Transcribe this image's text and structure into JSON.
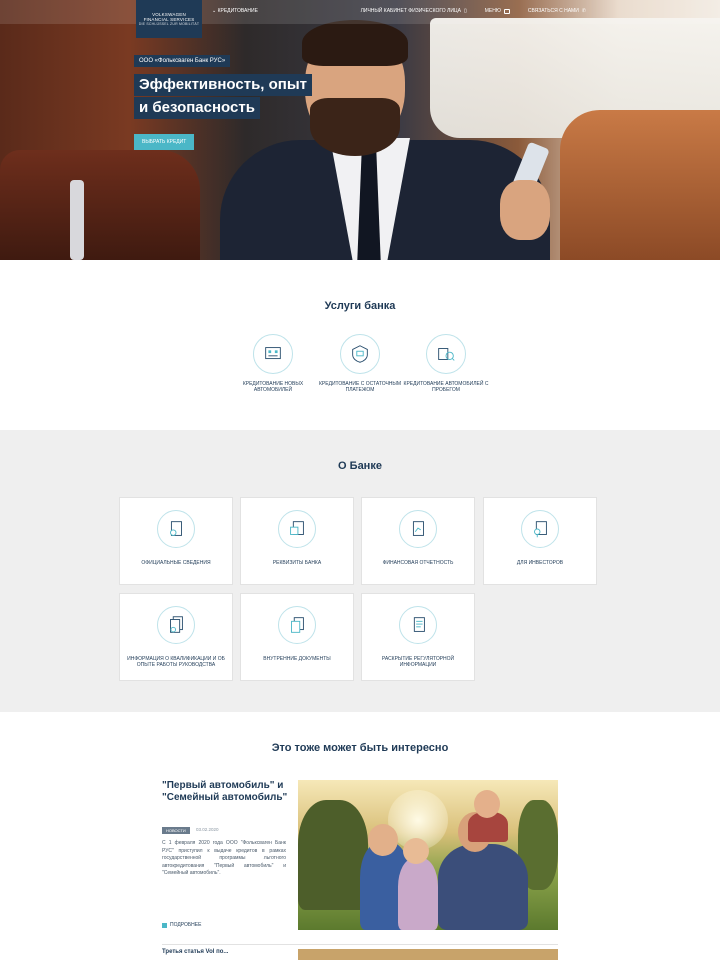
{
  "header": {
    "logo_lines": [
      "VOLKSWAGEN",
      "FINANCIAL SERVICES",
      "DIE SCHLÜSSEL ZUR MOBILITÄT"
    ],
    "nav_credit": "КРЕДИТОВАНИЕ",
    "nav_cabinet": "ЛИЧНЫЙ КАБИНЕТ ФИЗИЧЕСКОГО ЛИЦА",
    "nav_menu": "МЕНЮ",
    "nav_contact": "СВЯЗАТЬСЯ С НАМИ"
  },
  "hero": {
    "badge": "ООО «Фольксваген Банк РУС»",
    "title_line1": "Эффективность, опыт",
    "title_line2": "и безопасность",
    "button": "ВЫБРАТЬ КРЕДИТ"
  },
  "services": {
    "title": "Услуги банка",
    "items": [
      {
        "label": "КРЕДИТОВАНИЕ НОВЫХ АВТОМОБИЛЕЙ",
        "icon": "new-car-icon"
      },
      {
        "label": "КРЕДИТОВАНИЕ С ОСТАТОЧНЫМ ПЛАТЕЖОМ",
        "icon": "residual-payment-icon"
      },
      {
        "label": "КРЕДИТОВАНИЕ АВТОМОБИЛЕЙ С ПРОБЕГОМ",
        "icon": "used-car-icon"
      }
    ]
  },
  "about": {
    "title": "О Банке",
    "cards": [
      {
        "label": "ОФИЦИАЛЬНЫЕ СВЕДЕНИЯ",
        "icon": "document-user-icon"
      },
      {
        "label": "РЕКВИЗИТЫ БАНКА",
        "icon": "document-details-icon"
      },
      {
        "label": "ФИНАНСОВАЯ ОТЧЕТНОСТЬ",
        "icon": "document-report-icon"
      },
      {
        "label": "ДЛЯ ИНВЕСТОРОВ",
        "icon": "document-investor-icon"
      },
      {
        "label": "ИНФОРМАЦИЯ О КВАЛИФИКАЦИИ И ОБ ОПЫТЕ РАБОТЫ РУКОВОДСТВА",
        "icon": "document-certificate-icon"
      },
      {
        "label": "ВНУТРЕННИЕ ДОКУМЕНТЫ",
        "icon": "documents-icon"
      },
      {
        "label": "РАСКРЫТИЕ РЕГУЛЯТОРНОЙ ИНФОРМАЦИИ",
        "icon": "document-regulatory-icon"
      }
    ]
  },
  "interest": {
    "title": "Это тоже может быть интересно",
    "article": {
      "title": "\"Первый автомобиль\" и \"Семейный автомобиль\"",
      "tag": "НОВОСТИ",
      "date": "03.02.2020",
      "text": "С 1 февраля 2020 года ООО \"Фольксваген Банк РУС\" приступил к выдаче кредитов в рамках государственной программы льготного автокредитования \"Первый автомобиль\" и \"Семейный автомобиль\".",
      "more": "ПОДРОБНЕЕ"
    },
    "next_title": "Третья статья Vol по..."
  }
}
